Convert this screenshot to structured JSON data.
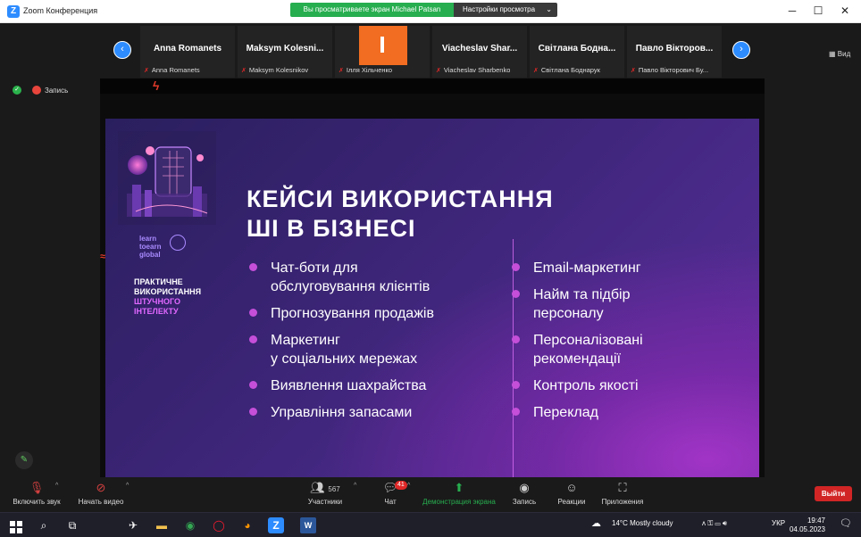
{
  "window": {
    "title": "Zoom Конференция",
    "share_banner": "Вы просматриваете экран Michael Patsan",
    "view_settings": "Настройки просмотра",
    "view_label": "Вид"
  },
  "gallery": [
    {
      "big": "Anna Romanets",
      "small": "Anna Romanets"
    },
    {
      "big": "Maksym  Kolesni...",
      "small": "Maksym Kolesnikov"
    },
    {
      "big": "",
      "small": "Ілля Хільченко",
      "orange": true
    },
    {
      "big": "Viacheslav  Shar...",
      "small": "Viacheslav Sharbenko"
    },
    {
      "big": "Світлана  Бодна...",
      "small": "Світлана Боднарук"
    },
    {
      "big": "Павло  Вікторов...",
      "small": "Павло Вікторович Бу..."
    }
  ],
  "status": {
    "recording": "Запись"
  },
  "slide": {
    "headline_1": "КЕЙСИ ВИКОРИСТАННЯ",
    "headline_2": "ШІ В БІЗНЕСІ",
    "logo": [
      "learn",
      "toearn",
      "global"
    ],
    "side_1": "ПРАКТИЧНЕ",
    "side_2": "ВИКОРИСТАННЯ",
    "side_3": "ШТУЧНОГО",
    "side_4": "ІНТЕЛЕКТУ",
    "left_items": [
      "Чат-боти для\nобслуговування клієнтів",
      "Прогнозування продажів",
      "Маркетинг\nу соціальних мережах",
      "Виявлення шахрайства",
      "Управління запасами"
    ],
    "right_items": [
      "Email-маркетинг",
      "Найм та підбір\nперсоналу",
      "Персоналізовані\nрекомендації",
      "Контроль якості",
      "Переклад"
    ]
  },
  "toolbar": {
    "unmute": "Включить звук",
    "start_video": "Начать видео",
    "participants": "Участники",
    "participants_count": "567",
    "chat": "Чат",
    "chat_badge": "41",
    "share": "Демонстрация экрана",
    "record": "Запись",
    "reactions": "Реакции",
    "apps": "Приложения",
    "leave": "Выйти"
  },
  "taskbar": {
    "weather": "14°C  Mostly cloudy",
    "lang": "УКР",
    "time": "19:47",
    "date": "04.05.2023"
  }
}
